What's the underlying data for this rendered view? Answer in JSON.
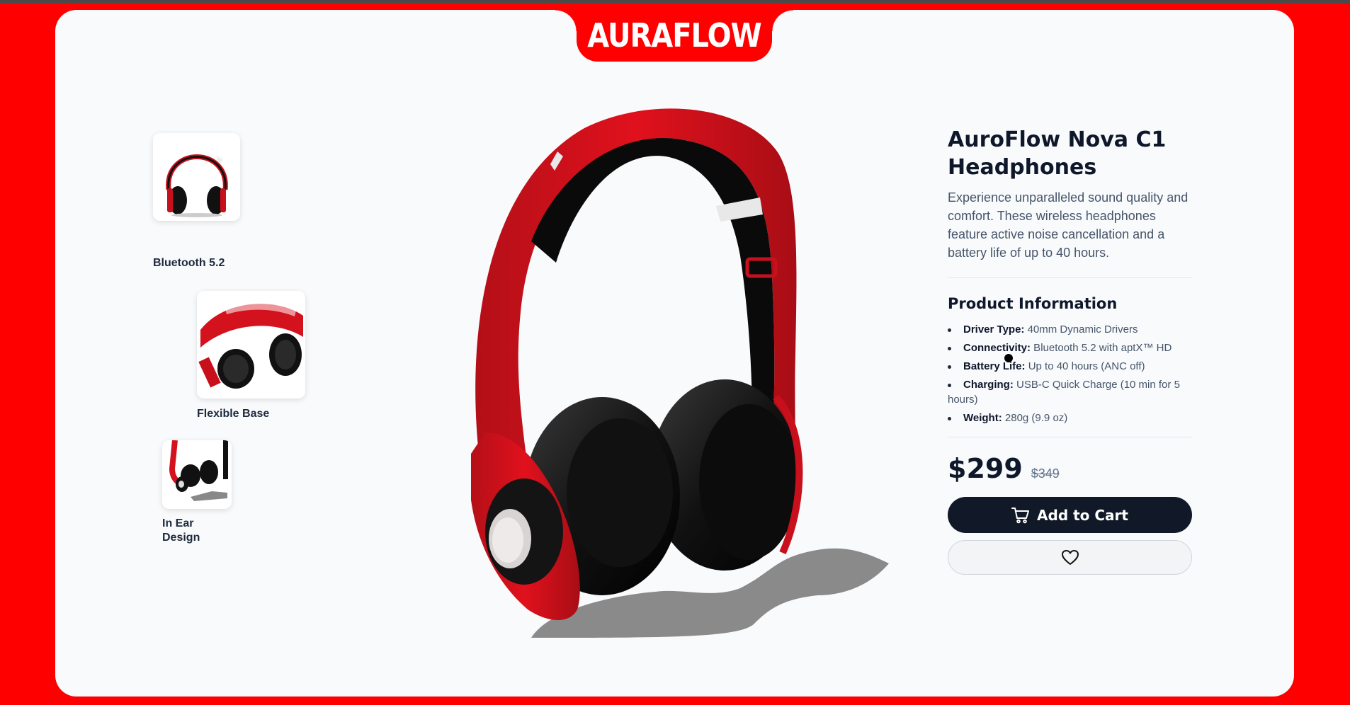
{
  "brand": {
    "name": "AURAFLOW"
  },
  "thumbnails": [
    {
      "label": "Bluetooth 5.2"
    },
    {
      "label": "Flexible Base"
    },
    {
      "label_line1": "In Ear",
      "label_line2": "Design"
    }
  ],
  "product": {
    "title_line1": "AuroFlow Nova C1",
    "title_line2": "Headphones",
    "description": "Experience unparalleled sound quality and comfort. These wireless headphones feature active noise cancellation and a battery life of up to 40 hours.",
    "info_heading": "Product Information",
    "specs": [
      {
        "key": "Driver Type:",
        "value": " 40mm Dynamic Drivers"
      },
      {
        "key": "Connectivity:",
        "value": " Bluetooth 5.2 with aptX™ HD"
      },
      {
        "key": "Battery Life:",
        "value": " Up to 40 hours (ANC off)"
      },
      {
        "key": "Charging:",
        "value": " USB-C Quick Charge (10 min for 5 hours)"
      },
      {
        "key": "Weight:",
        "value": " 280g (9.9 oz)"
      }
    ],
    "price": "$299",
    "old_price": "$349",
    "add_to_cart_label": "Add to Cart"
  },
  "icons": {
    "cart": "cart-icon",
    "wishlist": "heart-icon"
  },
  "colors": {
    "background": "#ff0000",
    "card": "#f8fafc",
    "primary_button": "#111827",
    "headphone_red": "#d4121e"
  }
}
